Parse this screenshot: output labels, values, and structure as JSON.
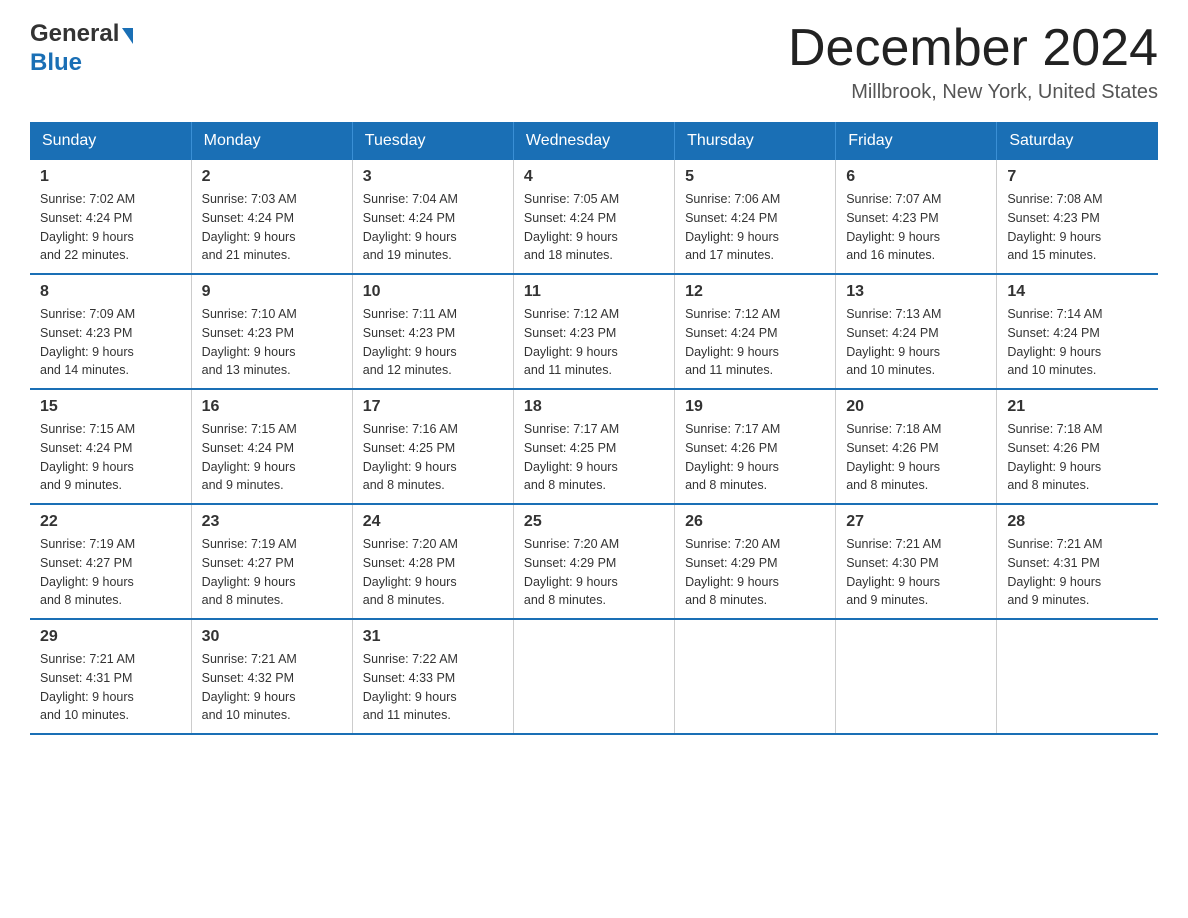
{
  "logo": {
    "general": "General",
    "blue": "Blue"
  },
  "header": {
    "month": "December 2024",
    "location": "Millbrook, New York, United States"
  },
  "days_of_week": [
    "Sunday",
    "Monday",
    "Tuesday",
    "Wednesday",
    "Thursday",
    "Friday",
    "Saturday"
  ],
  "weeks": [
    [
      {
        "day": "1",
        "sunrise": "7:02 AM",
        "sunset": "4:24 PM",
        "daylight": "9 hours and 22 minutes."
      },
      {
        "day": "2",
        "sunrise": "7:03 AM",
        "sunset": "4:24 PM",
        "daylight": "9 hours and 21 minutes."
      },
      {
        "day": "3",
        "sunrise": "7:04 AM",
        "sunset": "4:24 PM",
        "daylight": "9 hours and 19 minutes."
      },
      {
        "day": "4",
        "sunrise": "7:05 AM",
        "sunset": "4:24 PM",
        "daylight": "9 hours and 18 minutes."
      },
      {
        "day": "5",
        "sunrise": "7:06 AM",
        "sunset": "4:24 PM",
        "daylight": "9 hours and 17 minutes."
      },
      {
        "day": "6",
        "sunrise": "7:07 AM",
        "sunset": "4:23 PM",
        "daylight": "9 hours and 16 minutes."
      },
      {
        "day": "7",
        "sunrise": "7:08 AM",
        "sunset": "4:23 PM",
        "daylight": "9 hours and 15 minutes."
      }
    ],
    [
      {
        "day": "8",
        "sunrise": "7:09 AM",
        "sunset": "4:23 PM",
        "daylight": "9 hours and 14 minutes."
      },
      {
        "day": "9",
        "sunrise": "7:10 AM",
        "sunset": "4:23 PM",
        "daylight": "9 hours and 13 minutes."
      },
      {
        "day": "10",
        "sunrise": "7:11 AM",
        "sunset": "4:23 PM",
        "daylight": "9 hours and 12 minutes."
      },
      {
        "day": "11",
        "sunrise": "7:12 AM",
        "sunset": "4:23 PM",
        "daylight": "9 hours and 11 minutes."
      },
      {
        "day": "12",
        "sunrise": "7:12 AM",
        "sunset": "4:24 PM",
        "daylight": "9 hours and 11 minutes."
      },
      {
        "day": "13",
        "sunrise": "7:13 AM",
        "sunset": "4:24 PM",
        "daylight": "9 hours and 10 minutes."
      },
      {
        "day": "14",
        "sunrise": "7:14 AM",
        "sunset": "4:24 PM",
        "daylight": "9 hours and 10 minutes."
      }
    ],
    [
      {
        "day": "15",
        "sunrise": "7:15 AM",
        "sunset": "4:24 PM",
        "daylight": "9 hours and 9 minutes."
      },
      {
        "day": "16",
        "sunrise": "7:15 AM",
        "sunset": "4:24 PM",
        "daylight": "9 hours and 9 minutes."
      },
      {
        "day": "17",
        "sunrise": "7:16 AM",
        "sunset": "4:25 PM",
        "daylight": "9 hours and 8 minutes."
      },
      {
        "day": "18",
        "sunrise": "7:17 AM",
        "sunset": "4:25 PM",
        "daylight": "9 hours and 8 minutes."
      },
      {
        "day": "19",
        "sunrise": "7:17 AM",
        "sunset": "4:26 PM",
        "daylight": "9 hours and 8 minutes."
      },
      {
        "day": "20",
        "sunrise": "7:18 AM",
        "sunset": "4:26 PM",
        "daylight": "9 hours and 8 minutes."
      },
      {
        "day": "21",
        "sunrise": "7:18 AM",
        "sunset": "4:26 PM",
        "daylight": "9 hours and 8 minutes."
      }
    ],
    [
      {
        "day": "22",
        "sunrise": "7:19 AM",
        "sunset": "4:27 PM",
        "daylight": "9 hours and 8 minutes."
      },
      {
        "day": "23",
        "sunrise": "7:19 AM",
        "sunset": "4:27 PM",
        "daylight": "9 hours and 8 minutes."
      },
      {
        "day": "24",
        "sunrise": "7:20 AM",
        "sunset": "4:28 PM",
        "daylight": "9 hours and 8 minutes."
      },
      {
        "day": "25",
        "sunrise": "7:20 AM",
        "sunset": "4:29 PM",
        "daylight": "9 hours and 8 minutes."
      },
      {
        "day": "26",
        "sunrise": "7:20 AM",
        "sunset": "4:29 PM",
        "daylight": "9 hours and 8 minutes."
      },
      {
        "day": "27",
        "sunrise": "7:21 AM",
        "sunset": "4:30 PM",
        "daylight": "9 hours and 9 minutes."
      },
      {
        "day": "28",
        "sunrise": "7:21 AM",
        "sunset": "4:31 PM",
        "daylight": "9 hours and 9 minutes."
      }
    ],
    [
      {
        "day": "29",
        "sunrise": "7:21 AM",
        "sunset": "4:31 PM",
        "daylight": "9 hours and 10 minutes."
      },
      {
        "day": "30",
        "sunrise": "7:21 AM",
        "sunset": "4:32 PM",
        "daylight": "9 hours and 10 minutes."
      },
      {
        "day": "31",
        "sunrise": "7:22 AM",
        "sunset": "4:33 PM",
        "daylight": "9 hours and 11 minutes."
      },
      null,
      null,
      null,
      null
    ]
  ],
  "labels": {
    "sunrise": "Sunrise:",
    "sunset": "Sunset:",
    "daylight": "Daylight:"
  }
}
